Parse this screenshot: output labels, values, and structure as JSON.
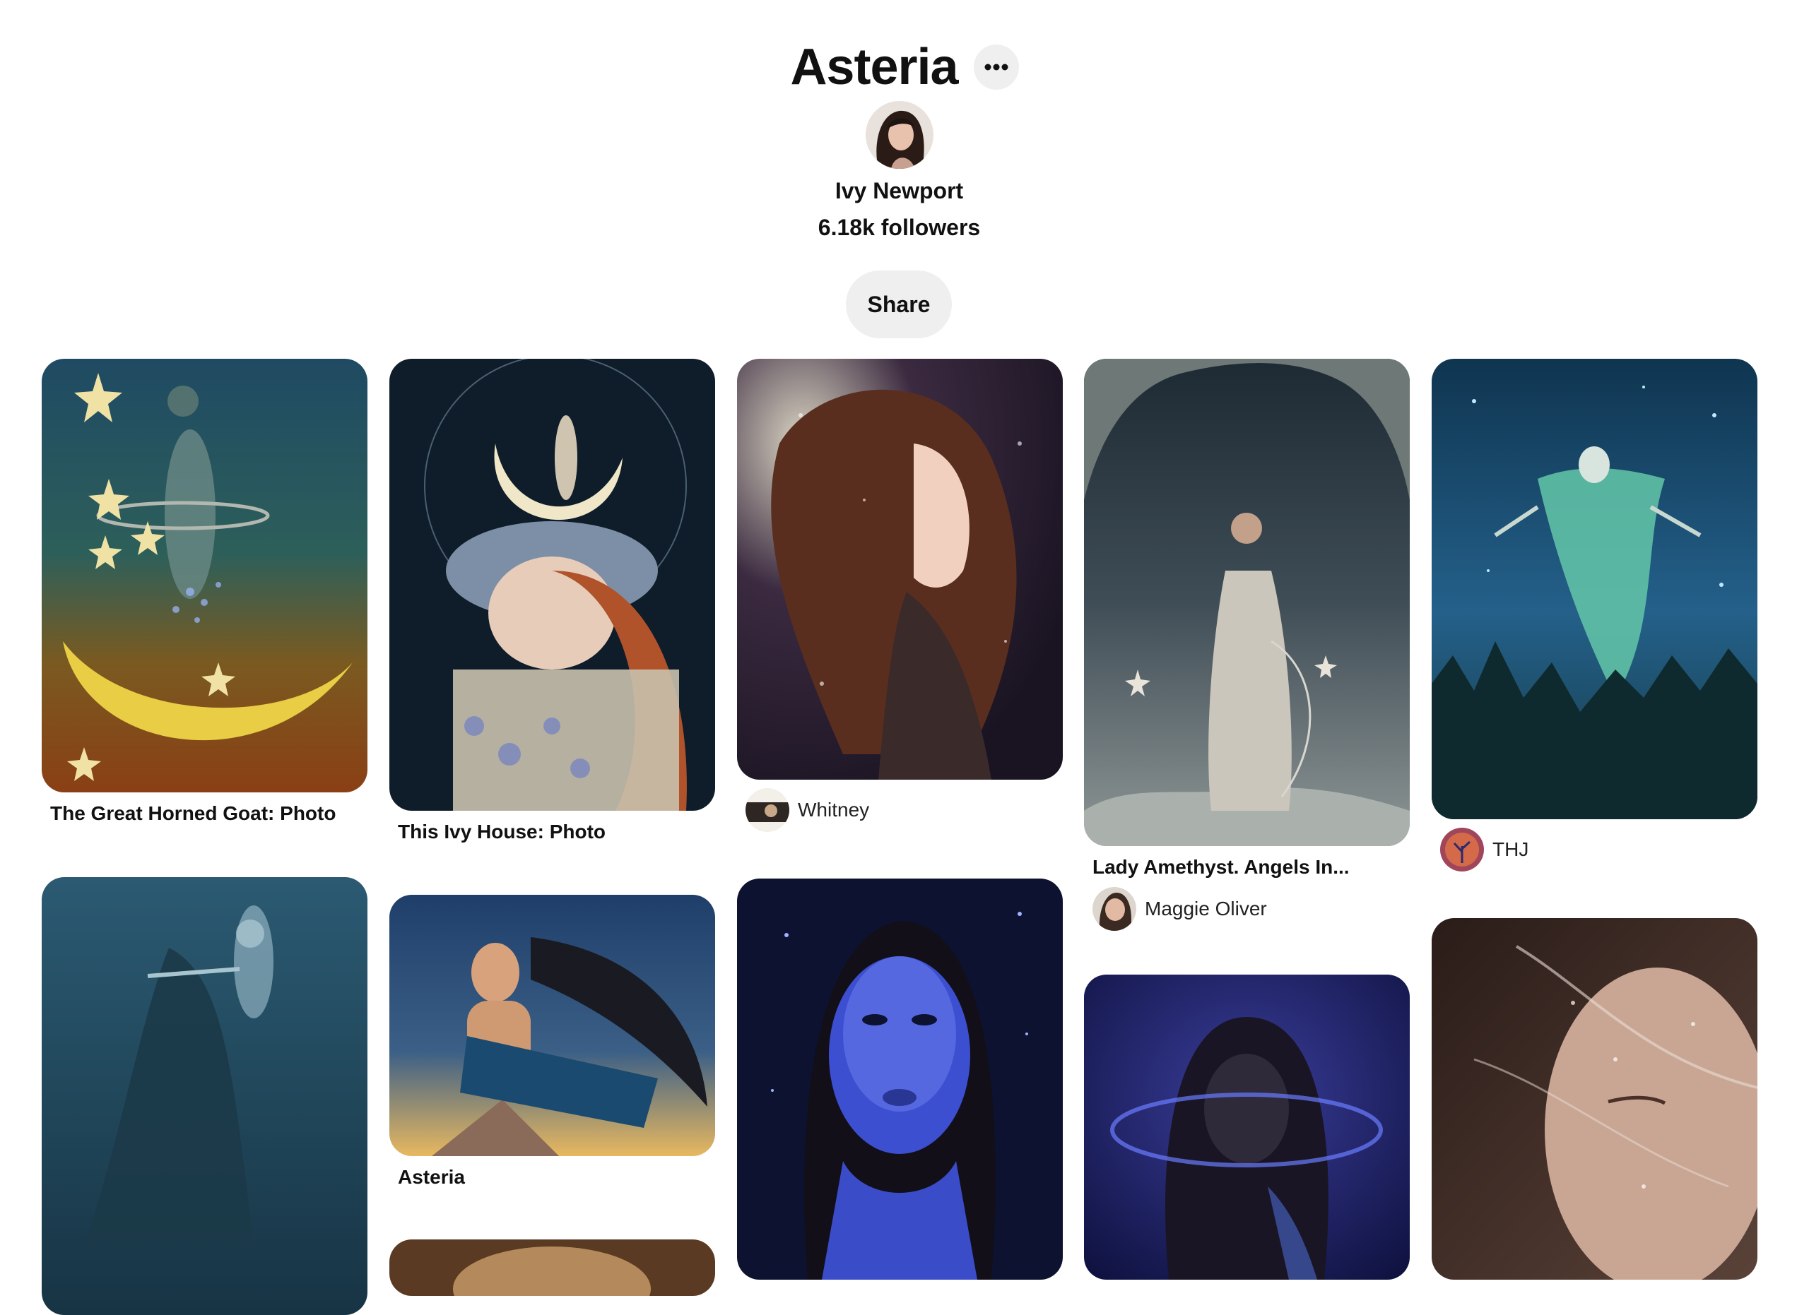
{
  "board": {
    "title": "Asteria",
    "owner_name": "Ivy Newport",
    "followers": "6.18k followers",
    "share_label": "Share",
    "more_icon": "ellipsis-icon"
  },
  "pins": [
    {
      "title": "The Great Horned Goat: Photo",
      "author": ""
    },
    {
      "title": "This Ivy House: Photo",
      "author": ""
    },
    {
      "title": "",
      "author": "Whitney"
    },
    {
      "title": "Lady Amethyst. Angels In...",
      "author": "Maggie Oliver"
    },
    {
      "title": "",
      "author": "THJ"
    },
    {
      "title": "",
      "author": ""
    },
    {
      "title": "Asteria",
      "author": ""
    },
    {
      "title": "",
      "author": ""
    },
    {
      "title": "",
      "author": ""
    },
    {
      "title": "",
      "author": ""
    },
    {
      "title": "",
      "author": ""
    }
  ],
  "colors": {
    "background": "#ffffff",
    "button_bg": "#efefef",
    "text": "#111111"
  }
}
